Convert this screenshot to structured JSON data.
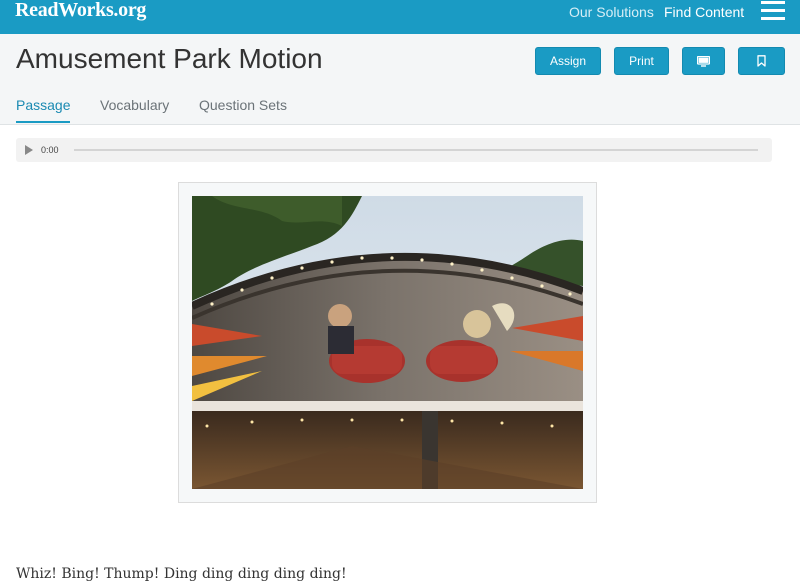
{
  "header": {
    "logo": "ReadWorks.org",
    "nav": {
      "solutions": "Our Solutions",
      "find_content": "Find Content"
    }
  },
  "passage": {
    "title": "Amusement Park Motion",
    "actions": {
      "assign": "Assign",
      "print": "Print"
    },
    "tabs": [
      "Passage",
      "Vocabulary",
      "Question Sets"
    ],
    "active_tab": "Passage",
    "audio": {
      "time": "0:00",
      "progress": 0
    },
    "body_first_line": "Whiz! Bing! Thump! Ding ding ding ding ding!"
  },
  "icons": {
    "menu": "hamburger-menu-icon",
    "present": "monitor-icon",
    "bookmark": "bookmark-icon",
    "play": "play-icon"
  },
  "colors": {
    "brand": "#1a9bc4",
    "title_bar": "#f4f6f7"
  }
}
